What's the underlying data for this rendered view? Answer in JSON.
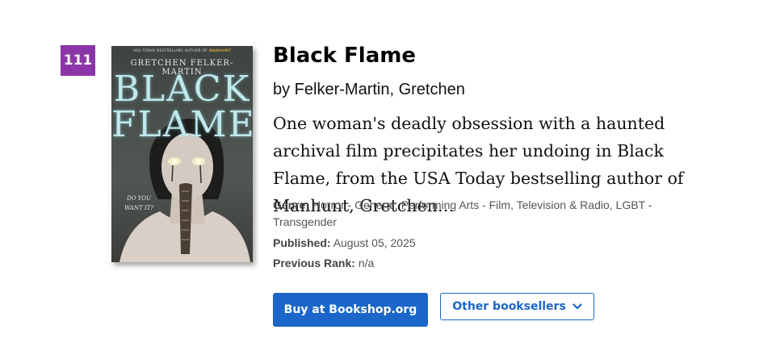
{
  "rank": "111",
  "book": {
    "title": "Black Flame",
    "byline": "by Felker-Martin, Gretchen",
    "description": "One woman's deadly obsession with a haunted archival film precipitates her undoing in Black Flame, from the USA Today bestselling author of Manhunt, Gretchen…"
  },
  "cover": {
    "top_line_prefix": "USA TODAY BESTSELLING AUTHOR OF",
    "top_line_book": "MANHUNT",
    "author": "GRETCHEN FELKER-MARTIN",
    "title_line_1": "BLACK",
    "title_line_2": "FLAME",
    "tagline": "DO YOU WANT IT?"
  },
  "meta": {
    "genre_label": "Genre:",
    "genre_value": "Horror - General, Performing Arts - Film, Television & Radio, LGBT - Transgender",
    "published_label": "Published:",
    "published_value": "August 05, 2025",
    "previous_rank_label": "Previous Rank:",
    "previous_rank_value": "n/a"
  },
  "actions": {
    "buy_label": "Buy at Bookshop.org",
    "other_label": "Other booksellers",
    "other_icon": "chevron-down-icon"
  },
  "colors": {
    "rank_badge": "#8b35a8",
    "primary_button": "#1a66c9",
    "cover_title": "#bfe7ec"
  }
}
